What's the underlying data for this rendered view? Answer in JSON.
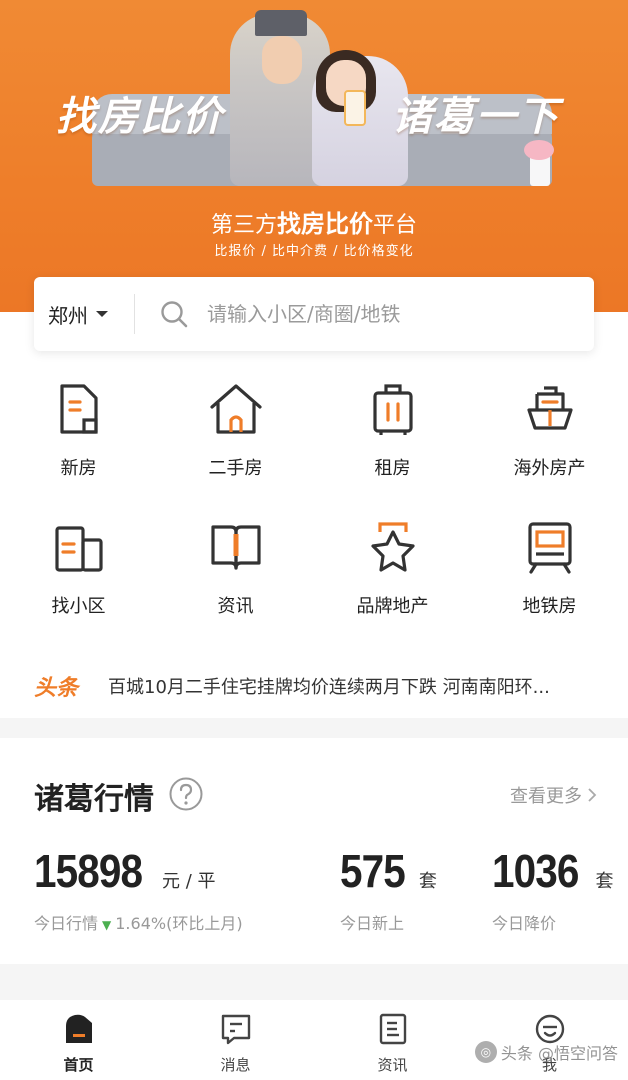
{
  "banner": {
    "slogan_left": "找房比价",
    "slogan_right": "诸葛一下",
    "subtitle_pre": "第三方",
    "subtitle_bold": "找房比价",
    "subtitle_post": "平台",
    "tags": "比报价 / 比中介费 / 比价格变化"
  },
  "search": {
    "city": "郑州",
    "placeholder": "请输入小区/商圈/地铁"
  },
  "grid": {
    "items": [
      {
        "label": "新房",
        "icon": "new-house-icon"
      },
      {
        "label": "二手房",
        "icon": "house-icon"
      },
      {
        "label": "租房",
        "icon": "luggage-icon"
      },
      {
        "label": "海外房产",
        "icon": "ship-icon"
      },
      {
        "label": "找小区",
        "icon": "community-icon"
      },
      {
        "label": "资讯",
        "icon": "book-icon"
      },
      {
        "label": "品牌地产",
        "icon": "star-icon"
      },
      {
        "label": "地铁房",
        "icon": "subway-icon"
      }
    ]
  },
  "ticker": {
    "tag": "头条",
    "text": "百城10月二手住宅挂牌均价连续两月下跌 河南南阳环..."
  },
  "market": {
    "title": "诸葛行情",
    "more": "查看更多",
    "stats": [
      {
        "value": "15898",
        "unit": "元 / 平",
        "caption_pre": "今日行情",
        "trend": "▼",
        "caption_post": "1.64%(环比上月)"
      },
      {
        "value": "575",
        "unit": "套",
        "caption": "今日新上"
      },
      {
        "value": "1036",
        "unit": "套",
        "caption": "今日降价"
      }
    ]
  },
  "tabs": [
    {
      "label": "首页",
      "icon": "home-icon",
      "active": true
    },
    {
      "label": "消息",
      "icon": "message-icon",
      "active": false
    },
    {
      "label": "资讯",
      "icon": "news-icon",
      "active": false
    },
    {
      "label": "我",
      "icon": "profile-icon",
      "active": false
    }
  ],
  "watermark": "头条 @悟空问答",
  "colors": {
    "brand_orange": "#ef7d29",
    "trend_down": "#4caf50",
    "text_primary": "#222222",
    "text_secondary": "#999999"
  }
}
